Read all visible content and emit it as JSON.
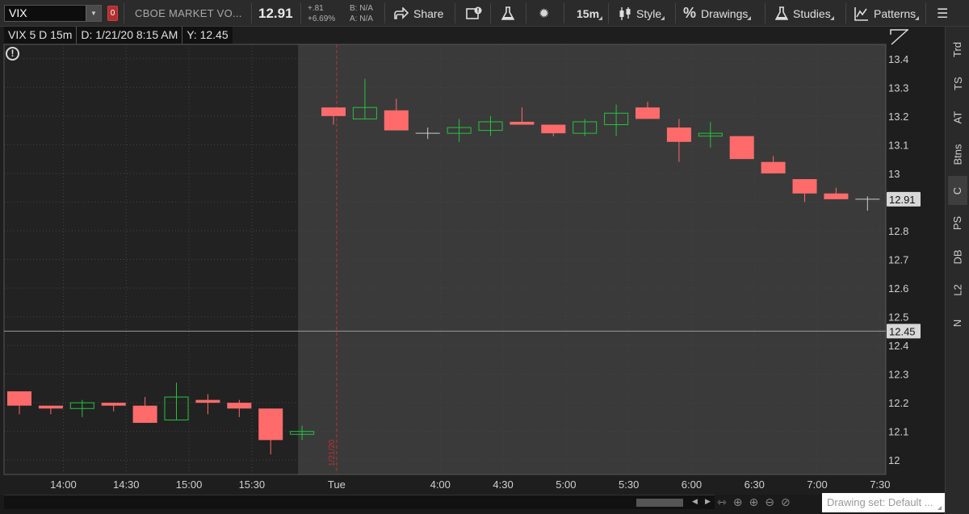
{
  "toolbar": {
    "symbol": "VIX",
    "symbol_tag": "0",
    "company": "CBOE MARKET VO...",
    "last_price": "12.91",
    "net_change": "+.81",
    "pct_change": "+6.69%",
    "bid": "B: N/A",
    "ask": "A: N/A",
    "share_label": "Share",
    "interval_label": "15m",
    "style_label": "Style",
    "drawings_label": "Drawings",
    "studies_label": "Studies",
    "patterns_label": "Patterns",
    "icons": {
      "share": "share-icon",
      "alert": "alert-icon",
      "flask": "flask-icon",
      "settings": "gear-icon",
      "style": "candles-icon",
      "drawings": "percent-icon",
      "studies": "flask-icon",
      "patterns": "patterns-icon",
      "more": "menu-icon"
    }
  },
  "chart_header": {
    "title": "VIX 5 D 15m",
    "date": "D: 1/21/20 8:15 AM",
    "cursor_y": "Y: 12.45"
  },
  "sidebar": {
    "tabs": [
      "Trd",
      "TS",
      "AT",
      "Btns",
      "C",
      "PS",
      "DB",
      "L2",
      "N"
    ],
    "active": "C"
  },
  "bottom": {
    "drawing_set": "Drawing set: Default ..."
  },
  "chart_data": {
    "type": "candlestick",
    "colors": {
      "up": "#27c23c",
      "down": "#ff6b6b",
      "doji": "#cccccc",
      "bg_pre": "#222222",
      "bg_session": "#3a3a3a"
    },
    "ylim": [
      11.95,
      13.45
    ],
    "yticks": [
      "13.4",
      "13.3",
      "13.2",
      "13.1",
      "13",
      "12.9",
      "12.8",
      "12.7",
      "12.6",
      "12.5",
      "12.4",
      "12.3",
      "12.2",
      "12.1",
      "12"
    ],
    "xticks": [
      {
        "label": "14:00",
        "slot": 1.4
      },
      {
        "label": "14:30",
        "slot": 3.4
      },
      {
        "label": "15:00",
        "slot": 5.4
      },
      {
        "label": "15:30",
        "slot": 7.4
      },
      {
        "label": "Tue",
        "slot": 10.1
      },
      {
        "label": "4:00",
        "slot": 13.4
      },
      {
        "label": "4:30",
        "slot": 15.4
      },
      {
        "label": "5:00",
        "slot": 17.4
      },
      {
        "label": "5:30",
        "slot": 19.4
      },
      {
        "label": "6:00",
        "slot": 21.4
      },
      {
        "label": "6:30",
        "slot": 23.4
      },
      {
        "label": "7:00",
        "slot": 25.4
      },
      {
        "label": "7:30",
        "slot": 27.4
      }
    ],
    "candles": [
      {
        "o": 12.24,
        "h": 12.24,
        "l": 12.16,
        "c": 12.19
      },
      {
        "o": 12.19,
        "h": 12.19,
        "l": 12.16,
        "c": 12.18
      },
      {
        "o": 12.18,
        "h": 12.21,
        "l": 12.15,
        "c": 12.2
      },
      {
        "o": 12.2,
        "h": 12.2,
        "l": 12.17,
        "c": 12.19
      },
      {
        "o": 12.19,
        "h": 12.22,
        "l": 12.13,
        "c": 12.13
      },
      {
        "o": 12.14,
        "h": 12.27,
        "l": 12.14,
        "c": 12.22
      },
      {
        "o": 12.21,
        "h": 12.23,
        "l": 12.16,
        "c": 12.2
      },
      {
        "o": 12.2,
        "h": 12.21,
        "l": 12.15,
        "c": 12.18
      },
      {
        "o": 12.18,
        "h": 12.18,
        "l": 12.02,
        "c": 12.07
      },
      {
        "o": 12.09,
        "h": 12.12,
        "l": 12.07,
        "c": 12.1
      },
      {
        "o": 13.23,
        "h": 13.23,
        "l": 13.17,
        "c": 13.2
      },
      {
        "o": 13.19,
        "h": 13.33,
        "l": 13.19,
        "c": 13.23
      },
      {
        "o": 13.22,
        "h": 13.26,
        "l": 13.15,
        "c": 13.15
      },
      {
        "o": 13.14,
        "h": 13.16,
        "l": 13.12,
        "c": 13.14
      },
      {
        "o": 13.14,
        "h": 13.19,
        "l": 13.11,
        "c": 13.16
      },
      {
        "o": 13.15,
        "h": 13.2,
        "l": 13.13,
        "c": 13.18
      },
      {
        "o": 13.18,
        "h": 13.23,
        "l": 13.17,
        "c": 13.17
      },
      {
        "o": 13.17,
        "h": 13.17,
        "l": 13.13,
        "c": 13.14
      },
      {
        "o": 13.14,
        "h": 13.19,
        "l": 13.13,
        "c": 13.18
      },
      {
        "o": 13.17,
        "h": 13.24,
        "l": 13.13,
        "c": 13.21
      },
      {
        "o": 13.23,
        "h": 13.25,
        "l": 13.19,
        "c": 13.19
      },
      {
        "o": 13.16,
        "h": 13.19,
        "l": 13.04,
        "c": 13.11
      },
      {
        "o": 13.13,
        "h": 13.18,
        "l": 13.09,
        "c": 13.14
      },
      {
        "o": 13.13,
        "h": 13.13,
        "l": 13.05,
        "c": 13.05
      },
      {
        "o": 13.04,
        "h": 13.06,
        "l": 13.0,
        "c": 13.0
      },
      {
        "o": 12.98,
        "h": 12.98,
        "l": 12.9,
        "c": 12.93
      },
      {
        "o": 12.93,
        "h": 12.95,
        "l": 12.91,
        "c": 12.91
      },
      {
        "o": 12.91,
        "h": 12.92,
        "l": 12.87,
        "c": 12.91
      }
    ],
    "session_start_slot": 9.0,
    "divider_slot": 10.1,
    "divider_label": "1/21/20",
    "crosshair_y": 12.45,
    "price_labels": {
      "last": "12.91",
      "cursor": "12.45"
    },
    "last_value": 12.91
  }
}
